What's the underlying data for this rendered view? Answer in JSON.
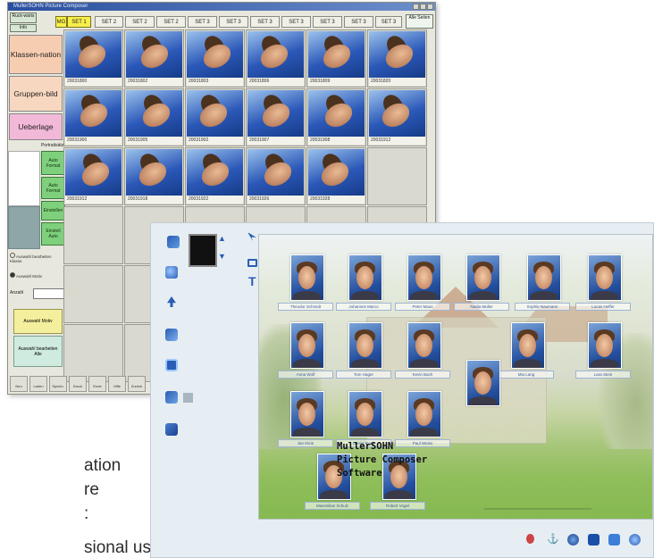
{
  "back_window": {
    "title": "MullerSOHN Picture Composer",
    "top_left_buttons": [
      "Ruck-wärts",
      "Info"
    ],
    "tabs": [
      "MG",
      "SET 1",
      "SET 2",
      "SET 2",
      "SET 2",
      "SET 3",
      "SET 3",
      "SET 3",
      "SET 3",
      "SET 3",
      "SET 3",
      "SET 3"
    ],
    "tabs_right_button": "Alle Seiten",
    "side_buttons": [
      "Klassen-nation",
      "Gruppen-bild",
      "Ueberlage"
    ],
    "small_header": "Portraitsätze",
    "green_buttons": [
      "Auto Format",
      "Auto Format",
      "Einstellen",
      "Einstell Auto"
    ],
    "radio_labels": [
      "Auswahl bearbeiten Klasse",
      "Auswahl Motiv"
    ],
    "field_label": "Anzahl",
    "yellow_button": "Auswahl Motiv",
    "cyan_button": "Auswahl bearbeiten Alle",
    "photo_labels": [
      [
        "20031800",
        "20031802",
        "20031803",
        "20031806",
        "20031809",
        "20031820"
      ],
      [
        "20031900",
        "20031905",
        "20031902",
        "20031907",
        "20031908",
        "20031912"
      ],
      [
        "20031912",
        "20031918",
        "20031922",
        "20031926",
        "20031928"
      ]
    ],
    "bottom_buttons": [
      "Neu",
      "Laden",
      "Speich.",
      "Druck",
      "Ende",
      "Hilfe",
      "Zurück"
    ]
  },
  "front_window": {
    "brand_lines": [
      "MullerSOHN",
      "Picture Composer",
      "Software"
    ],
    "name_labels_row1": [
      "Theodor Schmidt",
      "Johannes Marco",
      "Peter Maus",
      "Nadia Muller",
      "Sophie Naumann",
      "Lucas Hoffer"
    ],
    "name_labels_row2": [
      "Anna Wolf",
      "Tom Hager",
      "Kevin Bach",
      "Mia Lang",
      "Lara Stein"
    ],
    "name_labels_row3": [
      "Jan Klein",
      "Daniel Rose",
      "Paul Weiss"
    ],
    "name_labels_row4": [
      "Maximilian Schulz",
      "Robert Vogel"
    ]
  },
  "left_text_fragments": [
    "ation",
    "re",
    ":",
    "sional user"
  ],
  "colors": {
    "tab_active": "#f9ef4b",
    "side_btn_1": "#f7cdb1",
    "side_btn_2": "#f8d7c0",
    "side_btn_3": "#f2b8d8",
    "green_btn": "#7fd07c",
    "yellow_btn": "#f4ef9c"
  }
}
